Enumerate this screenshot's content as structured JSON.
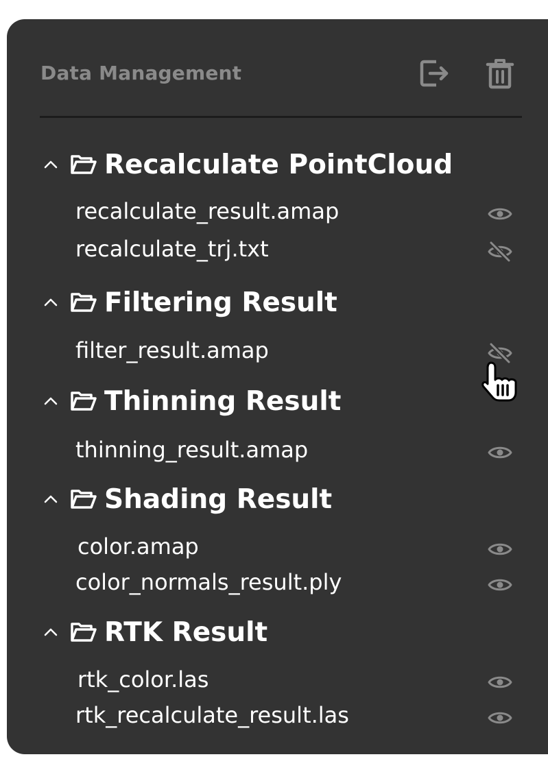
{
  "panel": {
    "title": "Data Management",
    "export_icon": "export-icon",
    "delete_icon": "trash-icon"
  },
  "groups": [
    {
      "title": "Recalculate PointCloud",
      "expanded": true,
      "items": [
        {
          "name": "recalculate_result.amap",
          "visible": true
        },
        {
          "name": "recalculate_trj.txt",
          "visible": false
        }
      ]
    },
    {
      "title": "Filtering Result",
      "expanded": true,
      "items": [
        {
          "name": "filter_result.amap",
          "visible": false
        }
      ]
    },
    {
      "title": "Thinning Result",
      "expanded": true,
      "items": [
        {
          "name": "thinning_result.amap",
          "visible": true
        }
      ]
    },
    {
      "title": "Shading Result",
      "expanded": true,
      "items": [
        {
          "name": "color.amap",
          "visible": true
        },
        {
          "name": "color_normals_result.ply",
          "visible": true
        }
      ]
    },
    {
      "title": "RTK Result",
      "expanded": true,
      "items": [
        {
          "name": "rtk_color.las",
          "visible": true
        },
        {
          "name": "rtk_recalculate_result.las",
          "visible": true
        }
      ]
    }
  ],
  "colors": {
    "panel_bg": "#333333",
    "text": "#ffffff",
    "title_text": "#8a8a8a",
    "icon_gray": "#8a8a8a",
    "divider": "#1c1c1c"
  }
}
